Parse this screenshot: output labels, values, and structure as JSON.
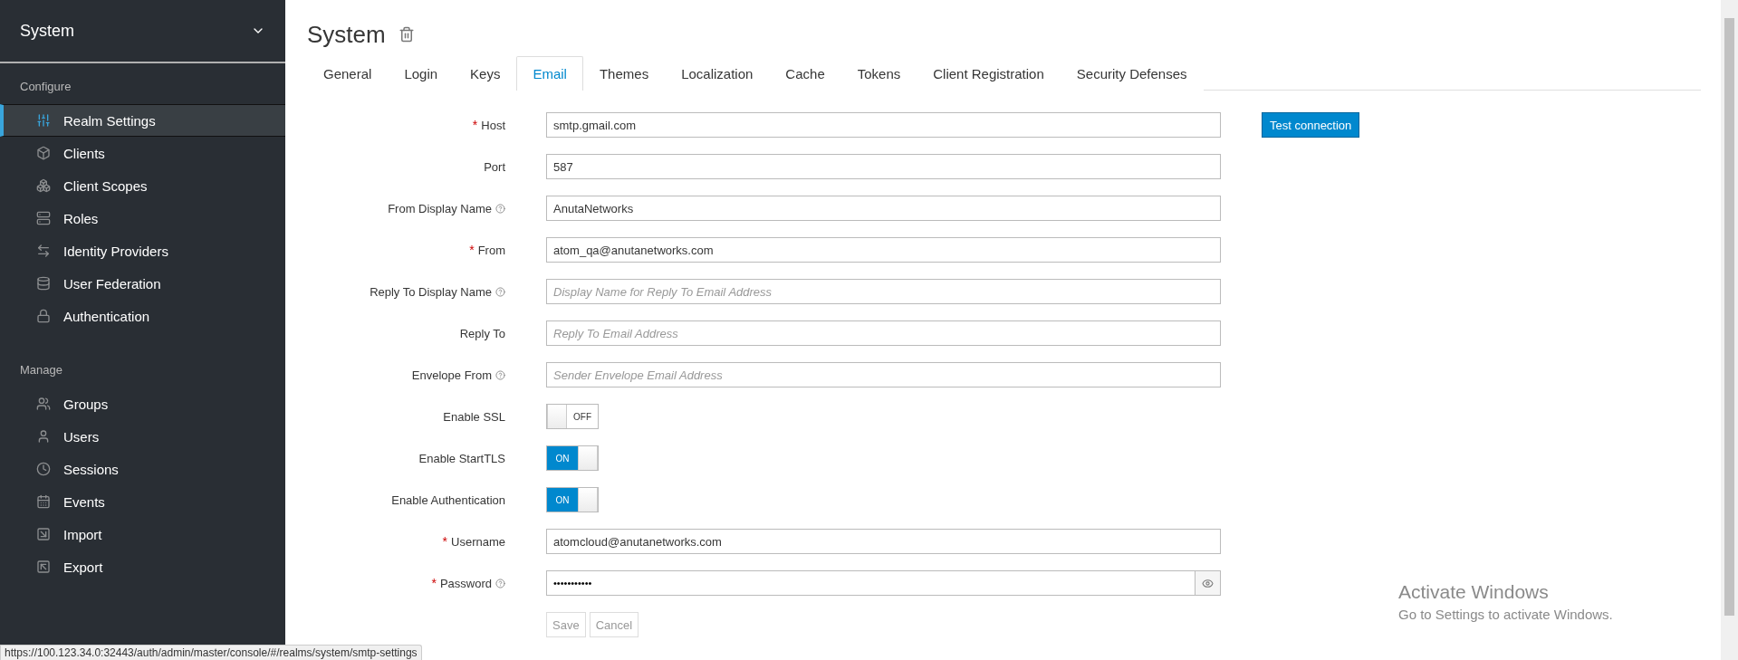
{
  "sidebar": {
    "realm": "System",
    "sections": [
      {
        "title": "Configure",
        "items": [
          {
            "label": "Realm Settings",
            "selected": true
          },
          {
            "label": "Clients",
            "selected": false
          },
          {
            "label": "Client Scopes",
            "selected": false
          },
          {
            "label": "Roles",
            "selected": false
          },
          {
            "label": "Identity Providers",
            "selected": false
          },
          {
            "label": "User Federation",
            "selected": false
          },
          {
            "label": "Authentication",
            "selected": false
          }
        ]
      },
      {
        "title": "Manage",
        "items": [
          {
            "label": "Groups",
            "selected": false
          },
          {
            "label": "Users",
            "selected": false
          },
          {
            "label": "Sessions",
            "selected": false
          },
          {
            "label": "Events",
            "selected": false
          },
          {
            "label": "Import",
            "selected": false
          },
          {
            "label": "Export",
            "selected": false
          }
        ]
      }
    ]
  },
  "page": {
    "title": "System"
  },
  "tabs": [
    {
      "label": "General",
      "selected": false
    },
    {
      "label": "Login",
      "selected": false
    },
    {
      "label": "Keys",
      "selected": false
    },
    {
      "label": "Email",
      "selected": true
    },
    {
      "label": "Themes",
      "selected": false
    },
    {
      "label": "Localization",
      "selected": false
    },
    {
      "label": "Cache",
      "selected": false
    },
    {
      "label": "Tokens",
      "selected": false
    },
    {
      "label": "Client Registration",
      "selected": false
    },
    {
      "label": "Security Defenses",
      "selected": false
    }
  ],
  "form": {
    "test_button": "Test connection",
    "fields": [
      {
        "kind": "text",
        "label": "Host",
        "required_mark": "*",
        "value": "smtp.gmail.com"
      },
      {
        "kind": "text",
        "label": "Port",
        "value": "587"
      },
      {
        "kind": "text",
        "label": "From Display Name",
        "help": true,
        "value": "AnutaNetworks"
      },
      {
        "kind": "text",
        "label": "From",
        "required_mark": "*",
        "value": "atom_qa@anutanetworks.com"
      },
      {
        "kind": "text",
        "label": "Reply To Display Name",
        "help": true,
        "placeholder": "Display Name for Reply To Email Address"
      },
      {
        "kind": "text",
        "label": "Reply To",
        "placeholder": "Reply To Email Address"
      },
      {
        "kind": "text",
        "label": "Envelope From",
        "help": true,
        "placeholder": "Sender Envelope Email Address"
      },
      {
        "kind": "toggle",
        "label": "Enable SSL",
        "on": false,
        "text": "OFF"
      },
      {
        "kind": "toggle",
        "label": "Enable StartTLS",
        "on": true,
        "text": "ON"
      },
      {
        "kind": "toggle",
        "label": "Enable Authentication",
        "on": true,
        "text": "ON"
      },
      {
        "kind": "text",
        "label": "Username",
        "required_mark": "*",
        "value": "atomcloud@anutanetworks.com"
      },
      {
        "kind": "password",
        "label": "Password",
        "required_mark": "*",
        "help": true,
        "value": "•••••••••••"
      }
    ],
    "buttons": [
      {
        "label": "Save",
        "disabled": true
      },
      {
        "label": "Cancel",
        "disabled": true
      }
    ]
  },
  "status_url": "https://100.123.34.0:32443/auth/admin/master/console/#/realms/system/smtp-settings",
  "os_notice": {
    "title": "Activate Windows",
    "text": "Go to Settings to activate Windows."
  }
}
